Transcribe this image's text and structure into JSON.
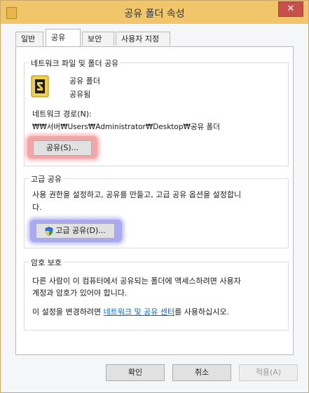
{
  "window": {
    "title": "공유 폴더 속성",
    "close_label": "✕"
  },
  "tabs": [
    {
      "label": "일반"
    },
    {
      "label": "공유"
    },
    {
      "label": "보안"
    },
    {
      "label": "사용자 지정"
    }
  ],
  "network_share": {
    "group_title": "네트워크 파일 및 폴더 공유",
    "folder_name": "공유 폴더",
    "status": "공유됨",
    "path_label": "네트워크 경로(N):",
    "path_value": "₩₩서버₩Users₩Administrator₩Desktop₩공유 폴더",
    "share_button": "공유(S)..."
  },
  "advanced_share": {
    "group_title": "고급 공유",
    "description_line1": "사용 권한을 설정하고, 공유를 만들고, 고급 공유 옵션을 설정합니",
    "description_line2": "다.",
    "button": "고급 공유(D)..."
  },
  "password_protection": {
    "group_title": "암호 보호",
    "line1": "다른 사람이 이 컴퓨터에서 공유되는 폴더에 액세스하려면 사용자",
    "line2": "계정과 암호가 있어야 합니다.",
    "line3_prefix": "이 설정을 변경하려면 ",
    "link": "네트워크 및 공유 센터",
    "line3_suffix": "를 사용하십시오."
  },
  "footer": {
    "ok": "확인",
    "cancel": "취소",
    "apply": "적용(A)"
  },
  "colors": {
    "titlebar": "#f1c569",
    "link": "#0066cc",
    "highlight_red": "#f4a6a6",
    "highlight_blue": "#a9a9f4"
  }
}
